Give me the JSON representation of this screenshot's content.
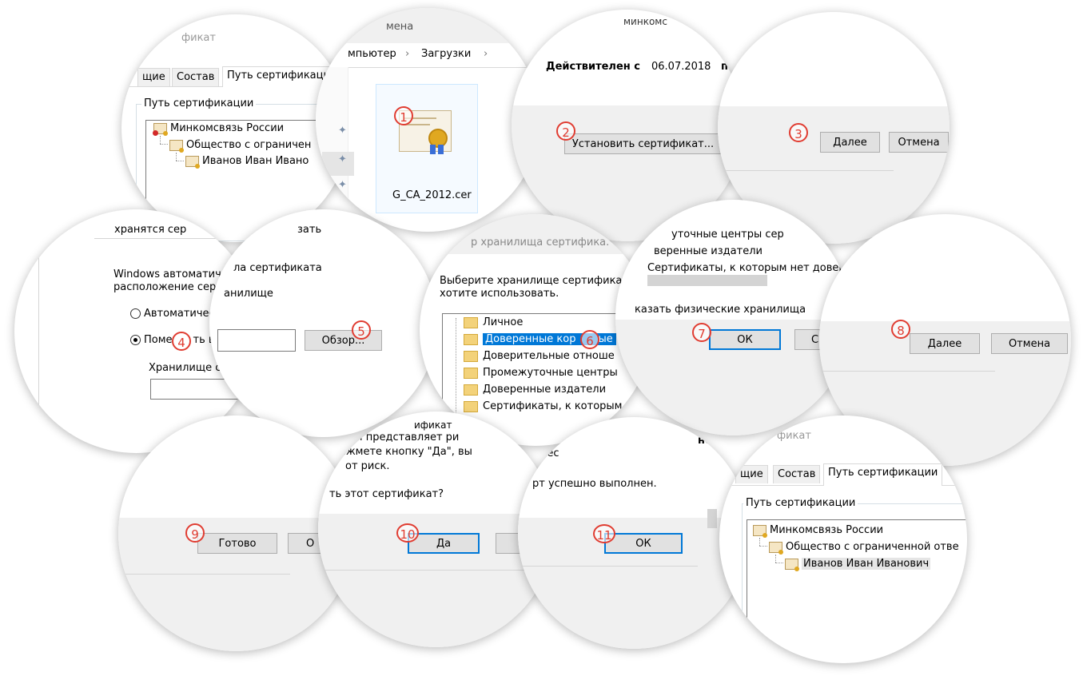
{
  "circle1": {
    "window_title_fragment": "фикат",
    "tabs": [
      "щие",
      "Состав",
      "Путь сертификаци"
    ],
    "group_label": "Путь сертификации",
    "tree": [
      "Минкомсвязь России",
      "Общество с ограничен",
      "Иванов Иван Ивано"
    ]
  },
  "circle2": {
    "title_fragment": "мена",
    "breadcrumb": [
      "мпьютер",
      "›",
      "Загрузки",
      "›"
    ],
    "file_name": "G_CA_2012.cer",
    "step": "1"
  },
  "circle3": {
    "top_fragment": "минкомс",
    "valid_from_label": "Действителен с",
    "valid_from_date": "06.07.2018",
    "valid_to_label": "по",
    "install_button": "Установить сертификат...",
    "step": "2"
  },
  "circle4": {
    "next_button": "Далее",
    "cancel_button": "Отмена",
    "step": "3"
  },
  "circle5": {
    "top_fragment": "хранятся сер",
    "text_line1": "Windows автоматичес",
    "text_line2": "расположение серти",
    "radio_auto": "Автоматичес",
    "radio_manual_a": "Поме",
    "radio_manual_b": "ть в",
    "store_label": "Хранилище с",
    "step": "4"
  },
  "circle6": {
    "top_fragment": "зать",
    "text_line1": "ла сертификата",
    "text_line2": "анилище",
    "browse_button": "Обзор...",
    "step": "5"
  },
  "circle7": {
    "title_fragment": "р хранилища сертифика.",
    "prompt_line1": "Выберите хранилище сертификатов",
    "prompt_line2": "хотите использовать.",
    "folders": [
      "Личное",
      "Доверенные кор",
      "Доверительные отноше",
      "Промежуточные центры",
      "Доверенные издатели",
      "Сертификаты, к которым н"
    ],
    "selected_suffix": "ые",
    "step": "6"
  },
  "circle8": {
    "list_fragments": [
      "уточные центры сер",
      "веренные издатели",
      "Сертификаты, к которым нет довер"
    ],
    "show_physical": "казать физические хранилища",
    "ok_button": "ОК",
    "cancel_fragment": "С",
    "step": "7"
  },
  "circle9": {
    "next_button": "Далее",
    "cancel_button": "Отмена",
    "step": "8"
  },
  "circle10": {
    "finish_button": "Готово",
    "cancel_fragment": "О",
    "step": "9"
  },
  "circle11": {
    "warn_top": "ификат",
    "warn_line1": "ком представляет ри",
    "warn_line2": "ажмете кнопку \"Да\", вы",
    "warn_line3": "от риск.",
    "question": "ть этот сертификат?",
    "yes_button": "Да",
    "step": "10"
  },
  "circle12": {
    "top_fragment": "ричес",
    "bold_fragment": "но",
    "message": "рт успешно выполнен.",
    "ok_button": "ОК",
    "step": "11"
  },
  "circle13": {
    "window_title_fragment": "фикат",
    "tabs": [
      "щие",
      "Состав",
      "Путь сертификации"
    ],
    "group_label": "Путь сертификации",
    "tree": [
      "Минкомсвязь России",
      "Общество с ограниченной отве",
      "Иванов Иван Иванович"
    ]
  }
}
